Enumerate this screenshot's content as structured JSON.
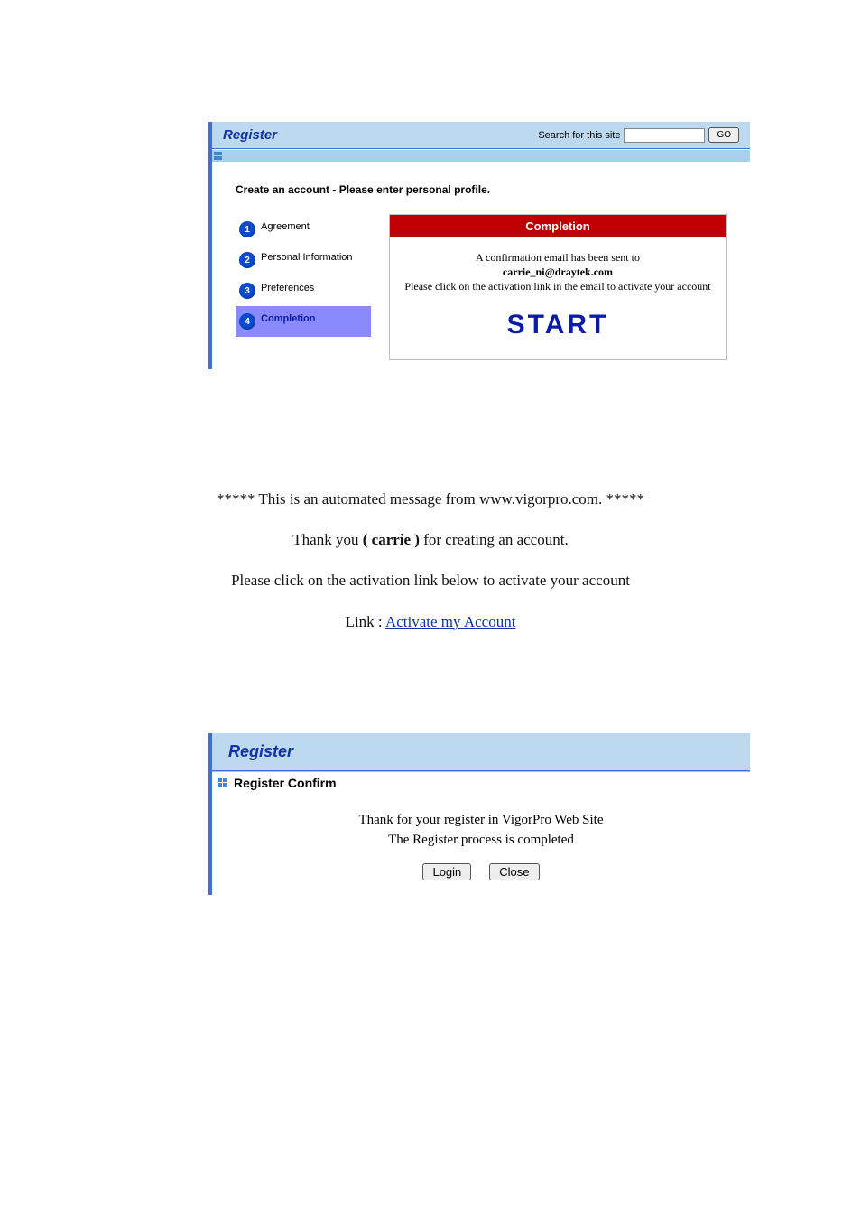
{
  "panel1": {
    "title": "Register",
    "searchLabel": "Search for this site",
    "searchPlaceholder": "",
    "goLabel": "GO",
    "instruction": "Create an account - Please enter personal profile.",
    "steps": [
      {
        "n": "1",
        "label": "Agreement"
      },
      {
        "n": "2",
        "label": "Personal Information"
      },
      {
        "n": "3",
        "label": "Preferences"
      },
      {
        "n": "4",
        "label": "Completion"
      }
    ],
    "activeStepIndex": 3,
    "main": {
      "heading": "Completion",
      "line1": "A confirmation email has been sent to",
      "email": "carrie_ni@draytek.com",
      "line2": "Please click on the activation link in the email to activate your account",
      "start": "START"
    }
  },
  "emailBlock": {
    "line1": "***** This is an automated message from www.vigorpro.com. *****",
    "thanksPrefix": "Thank you",
    "userDisplay": "( carrie )",
    "thanksSuffix": "for creating an account.",
    "line3": "Please click on the activation link below to activate your account",
    "linkLabel": "Link :",
    "linkText": "Activate my Account"
  },
  "panel2": {
    "title": "Register",
    "subheading": "Register Confirm",
    "line1": "Thank for your register in VigorPro Web Site",
    "line2": "The Register process is completed",
    "loginLabel": "Login",
    "closeLabel": "Close"
  }
}
